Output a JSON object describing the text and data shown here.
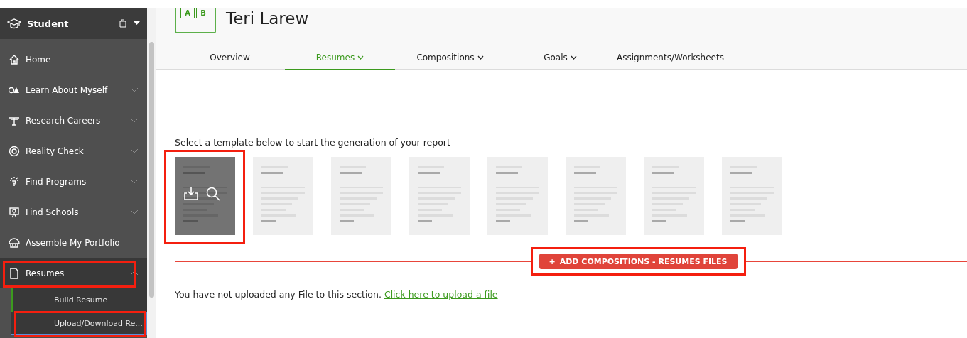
{
  "sidebar": {
    "title": "Student",
    "items": [
      {
        "label": "Home",
        "expandable": false,
        "expanded": false,
        "highlighted": false
      },
      {
        "label": "Learn About Myself",
        "expandable": true,
        "expanded": false,
        "highlighted": false
      },
      {
        "label": "Research Careers",
        "expandable": true,
        "expanded": false,
        "highlighted": false
      },
      {
        "label": "Reality Check",
        "expandable": true,
        "expanded": false,
        "highlighted": false
      },
      {
        "label": "Find Programs",
        "expandable": true,
        "expanded": false,
        "highlighted": false
      },
      {
        "label": "Find Schools",
        "expandable": true,
        "expanded": false,
        "highlighted": false
      },
      {
        "label": "Assemble My Portfolio",
        "expandable": false,
        "expanded": false,
        "highlighted": false
      },
      {
        "label": "Resumes",
        "expandable": true,
        "expanded": true,
        "highlighted": true,
        "children": [
          {
            "label": "Build Resume",
            "selected": true,
            "highlighted": false,
            "focused": false
          },
          {
            "label": "Upload/Download Re...",
            "selected": false,
            "highlighted": true,
            "focused": true
          }
        ]
      }
    ]
  },
  "header": {
    "logo_letters": [
      "A",
      "B"
    ],
    "name": "Teri Larew"
  },
  "tabs": [
    {
      "label": "Overview",
      "dropdown": false,
      "selected": false
    },
    {
      "label": "Resumes",
      "dropdown": true,
      "selected": true
    },
    {
      "label": "Compositions",
      "dropdown": true,
      "selected": false
    },
    {
      "label": "Goals",
      "dropdown": true,
      "selected": false
    },
    {
      "label": "Assignments/Worksheets",
      "dropdown": false,
      "selected": false
    }
  ],
  "prompt": "Select a template below to start the generation of your report",
  "templates": [
    {
      "selected": true,
      "highlighted": true
    },
    {
      "selected": false,
      "highlighted": false
    },
    {
      "selected": false,
      "highlighted": false
    },
    {
      "selected": false,
      "highlighted": false
    },
    {
      "selected": false,
      "highlighted": false
    },
    {
      "selected": false,
      "highlighted": false
    },
    {
      "selected": false,
      "highlighted": false
    },
    {
      "selected": false,
      "highlighted": false
    }
  ],
  "add_button": {
    "icon": "+",
    "label": "ADD COMPOSITIONS - RESUMES FILES",
    "highlighted": true
  },
  "empty_message": {
    "text": "You have not uploaded any File to this section.",
    "link": "Click here to upload a file"
  }
}
